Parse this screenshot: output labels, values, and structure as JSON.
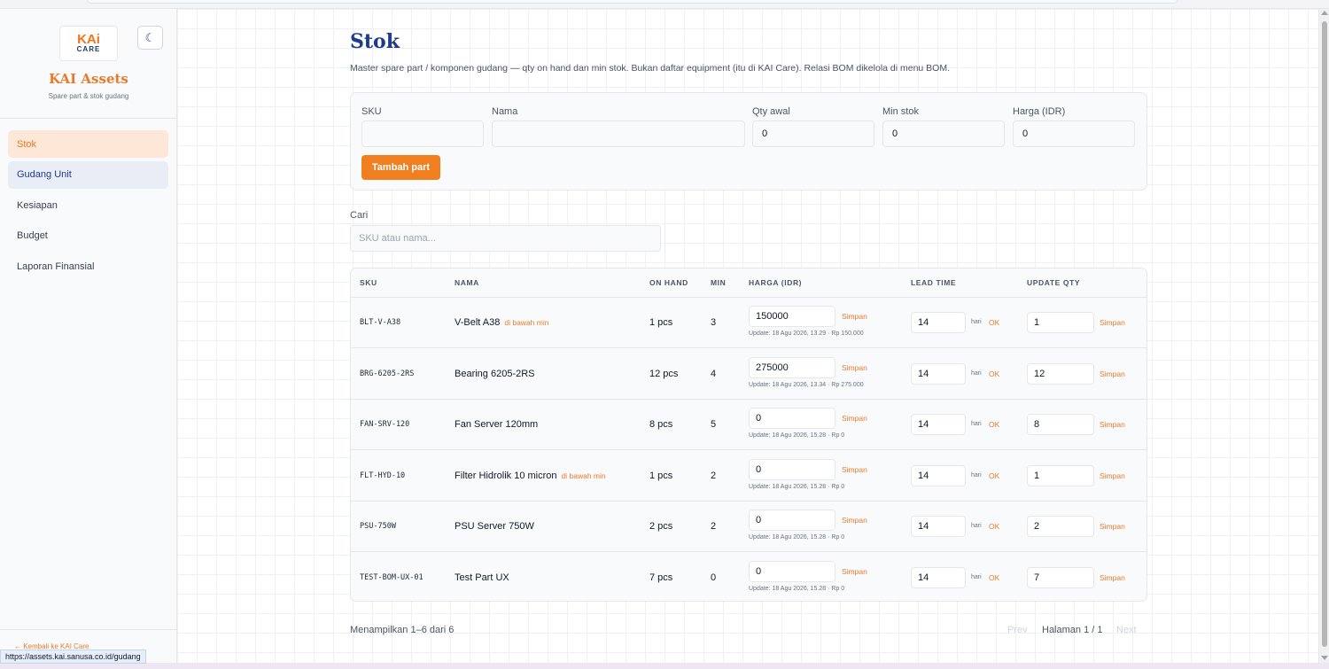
{
  "app": {
    "logo_text": "KAi",
    "logo_sub": "CARE",
    "brand_title": "KAI Assets",
    "brand_subtitle": "Spare part & stok gudang",
    "theme_icon": "moon-icon"
  },
  "sidebar": {
    "items": [
      {
        "label": "Stok",
        "state": "active"
      },
      {
        "label": "Gudang Unit",
        "state": "hover"
      },
      {
        "label": "Kesiapan",
        "state": ""
      },
      {
        "label": "Budget",
        "state": ""
      },
      {
        "label": "Laporan Finansial",
        "state": ""
      }
    ],
    "back_link": "← Kembali ke KAI Care"
  },
  "status_url": "https://assets.kai.sanusa.co.id/gudang",
  "page": {
    "title": "Stok",
    "description": "Master spare part / komponen gudang — qty on hand dan min stok. Bukan daftar equipment (itu di KAI Care). Relasi BOM dikelola di menu BOM."
  },
  "form": {
    "sku_label": "SKU",
    "sku_value": "",
    "name_label": "Nama",
    "name_value": "",
    "qty_label": "Qty awal",
    "qty_value": "0",
    "min_label": "Min stok",
    "min_value": "0",
    "price_label": "Harga (IDR)",
    "price_value": "0",
    "submit_label": "Tambah part"
  },
  "search": {
    "label": "Cari",
    "placeholder": "SKU atau nama..."
  },
  "table": {
    "headers": {
      "sku": "SKU",
      "name": "NAMA",
      "on_hand": "ON HAND",
      "min": "MIN",
      "price": "HARGA (IDR)",
      "lead": "LEAD TIME",
      "update_qty": "UPDATE QTY"
    },
    "save_label": "Simpan",
    "hari_label": "hari",
    "ok_label": "OK",
    "rows": [
      {
        "sku": "BLT-V-A38",
        "name": "V-Belt A38",
        "warn": "di bawah min",
        "on_hand": "1 pcs",
        "min": "3",
        "price": "150000",
        "update": "Update: 18 Agu 2026, 13.29 · Rp 150.000",
        "lead": "14",
        "qty": "1"
      },
      {
        "sku": "BRG-6205-2RS",
        "name": "Bearing 6205-2RS",
        "warn": "",
        "on_hand": "12 pcs",
        "min": "4",
        "price": "275000",
        "update": "Update: 18 Agu 2026, 13.34 · Rp 275.000",
        "lead": "14",
        "qty": "12"
      },
      {
        "sku": "FAN-SRV-120",
        "name": "Fan Server 120mm",
        "warn": "",
        "on_hand": "8 pcs",
        "min": "5",
        "price": "0",
        "update": "Update: 18 Agu 2026, 15.28 · Rp 0",
        "lead": "14",
        "qty": "8"
      },
      {
        "sku": "FLT-HYD-10",
        "name": "Filter Hidrolik 10 micron",
        "warn": "di bawah min",
        "on_hand": "1 pcs",
        "min": "2",
        "price": "0",
        "update": "Update: 18 Agu 2026, 15.28 · Rp 0",
        "lead": "14",
        "qty": "1"
      },
      {
        "sku": "PSU-750W",
        "name": "PSU Server 750W",
        "warn": "",
        "on_hand": "2 pcs",
        "min": "2",
        "price": "0",
        "update": "Update: 18 Agu 2026, 15.28 · Rp 0",
        "lead": "14",
        "qty": "2"
      },
      {
        "sku": "TEST-BOM-UX-01",
        "name": "Test Part UX",
        "warn": "",
        "on_hand": "7 pcs",
        "min": "0",
        "price": "0",
        "update": "Update: 18 Agu 2026, 15.28 · Rp 0",
        "lead": "14",
        "qty": "7"
      }
    ]
  },
  "pagination": {
    "info": "Menampilkan 1–6 dari 6",
    "prev": "Prev",
    "page": "Halaman 1 / 1",
    "next": "Next"
  },
  "colors": {
    "accent": "#f07f1f",
    "brand_blue": "#1e3a8a",
    "active_bg": "#fde7d6"
  }
}
